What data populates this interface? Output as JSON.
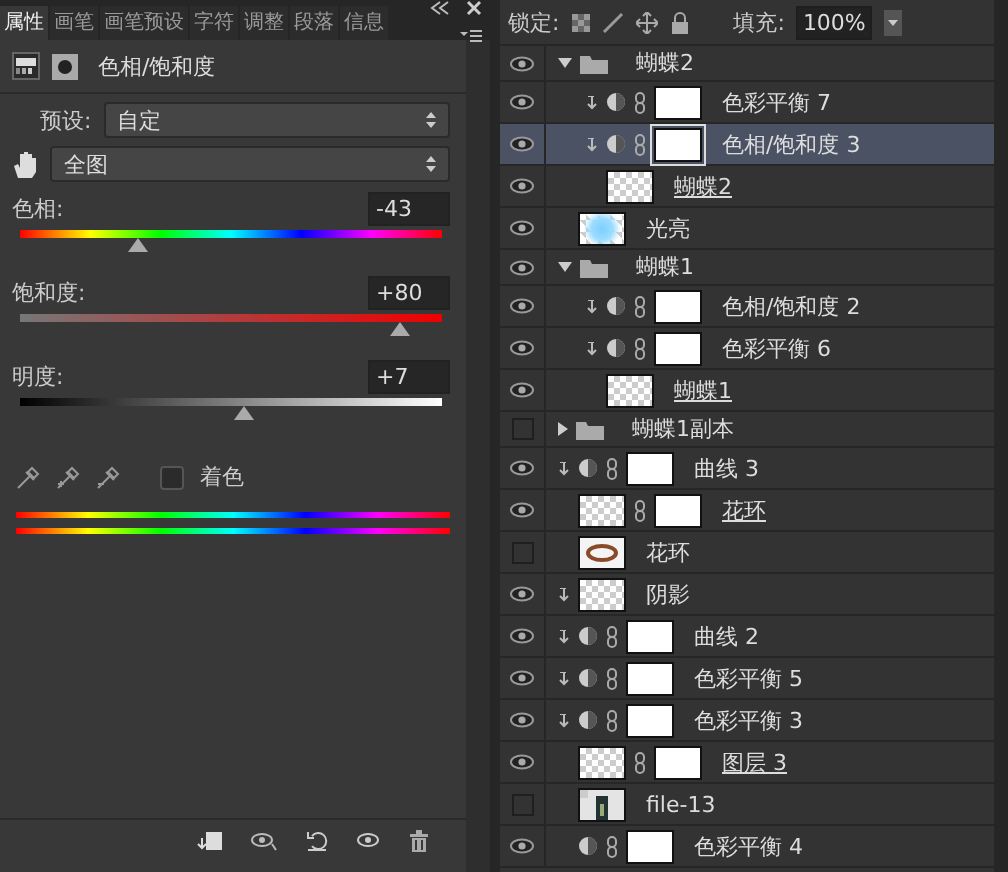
{
  "properties": {
    "tabs": [
      {
        "label": "属性",
        "selected": true
      },
      {
        "label": "画笔",
        "selected": false
      },
      {
        "label": "画笔预设",
        "selected": false
      },
      {
        "label": "字符",
        "selected": false
      },
      {
        "label": "调整",
        "selected": false
      },
      {
        "label": "段落",
        "selected": false
      },
      {
        "label": "信息",
        "selected": false
      }
    ],
    "title": "色相/饱和度",
    "preset": {
      "label": "预设:",
      "value": "自定"
    },
    "range": {
      "value": "全图"
    },
    "sliders": [
      {
        "label": "色相:",
        "value": "-43",
        "level": 0.28,
        "kind": "hue"
      },
      {
        "label": "饱和度:",
        "value": "+80",
        "level": 0.9,
        "kind": "saturation"
      },
      {
        "label": "明度:",
        "value": "+7",
        "level": 0.53,
        "kind": "lightness"
      }
    ],
    "colorize": {
      "label": "着色",
      "checked": false
    }
  },
  "layers": {
    "lock_label": "锁定:",
    "fill_label": "填充:",
    "fill_value": "100%",
    "rows": [
      {
        "kind": "group",
        "name": "蝴蝶2",
        "visible": true,
        "expanded": true,
        "selected": false,
        "children": [
          {
            "kind": "adjustment",
            "name": "色彩平衡 7",
            "visible": true,
            "clipped": true,
            "selected": false
          },
          {
            "kind": "adjustment",
            "name": "色相/饱和度 3",
            "visible": true,
            "clipped": true,
            "selected": true
          },
          {
            "kind": "transparent",
            "name": "蝴蝶2",
            "visible": true,
            "clipped": false,
            "mask": false,
            "underlined": true,
            "selected": false
          }
        ]
      },
      {
        "kind": "glow",
        "name": "光亮",
        "visible": true,
        "clipped": false,
        "mask": false,
        "underlined": false,
        "selected": false
      },
      {
        "kind": "group",
        "name": "蝴蝶1",
        "visible": true,
        "expanded": true,
        "selected": false,
        "children": [
          {
            "kind": "adjustment",
            "name": "色相/饱和度 2",
            "visible": true,
            "clipped": true,
            "selected": false
          },
          {
            "kind": "adjustment",
            "name": "色彩平衡 6",
            "visible": true,
            "clipped": true,
            "selected": false
          },
          {
            "kind": "transparent",
            "name": "蝴蝶1",
            "visible": true,
            "clipped": false,
            "mask": false,
            "underlined": true,
            "selected": false
          }
        ]
      },
      {
        "kind": "group",
        "name": "蝴蝶1副本",
        "visible": false,
        "expanded": false,
        "selected": false
      },
      {
        "kind": "adjustment",
        "name": "曲线 3",
        "visible": true,
        "clipped": true,
        "selected": false
      },
      {
        "kind": "transparent",
        "name": "花环",
        "visible": true,
        "clipped": false,
        "mask": true,
        "underlined": true,
        "selected": false
      },
      {
        "kind": "wreath",
        "name": "花环",
        "visible": false,
        "clipped": false,
        "mask": false,
        "underlined": false,
        "selected": false
      },
      {
        "kind": "transparent",
        "name": "阴影",
        "visible": true,
        "clipped": true,
        "mask": false,
        "underlined": false,
        "selected": false
      },
      {
        "kind": "adjustment",
        "name": "曲线 2",
        "visible": true,
        "clipped": true,
        "selected": false
      },
      {
        "kind": "adjustment",
        "name": "色彩平衡 5",
        "visible": true,
        "clipped": true,
        "selected": false
      },
      {
        "kind": "adjustment",
        "name": "色彩平衡 3",
        "visible": true,
        "clipped": true,
        "selected": false
      },
      {
        "kind": "transparent",
        "name": "图层 3",
        "visible": true,
        "clipped": false,
        "mask": true,
        "underlined": true,
        "selected": false
      },
      {
        "name": "file-13",
        "visible": false,
        "clipped": false,
        "mask": false,
        "underlined": false,
        "selected": false
      },
      {
        "kind": "adjustment",
        "name": "色彩平衡 4",
        "visible": true,
        "clipped": false,
        "selected": false
      }
    ]
  }
}
